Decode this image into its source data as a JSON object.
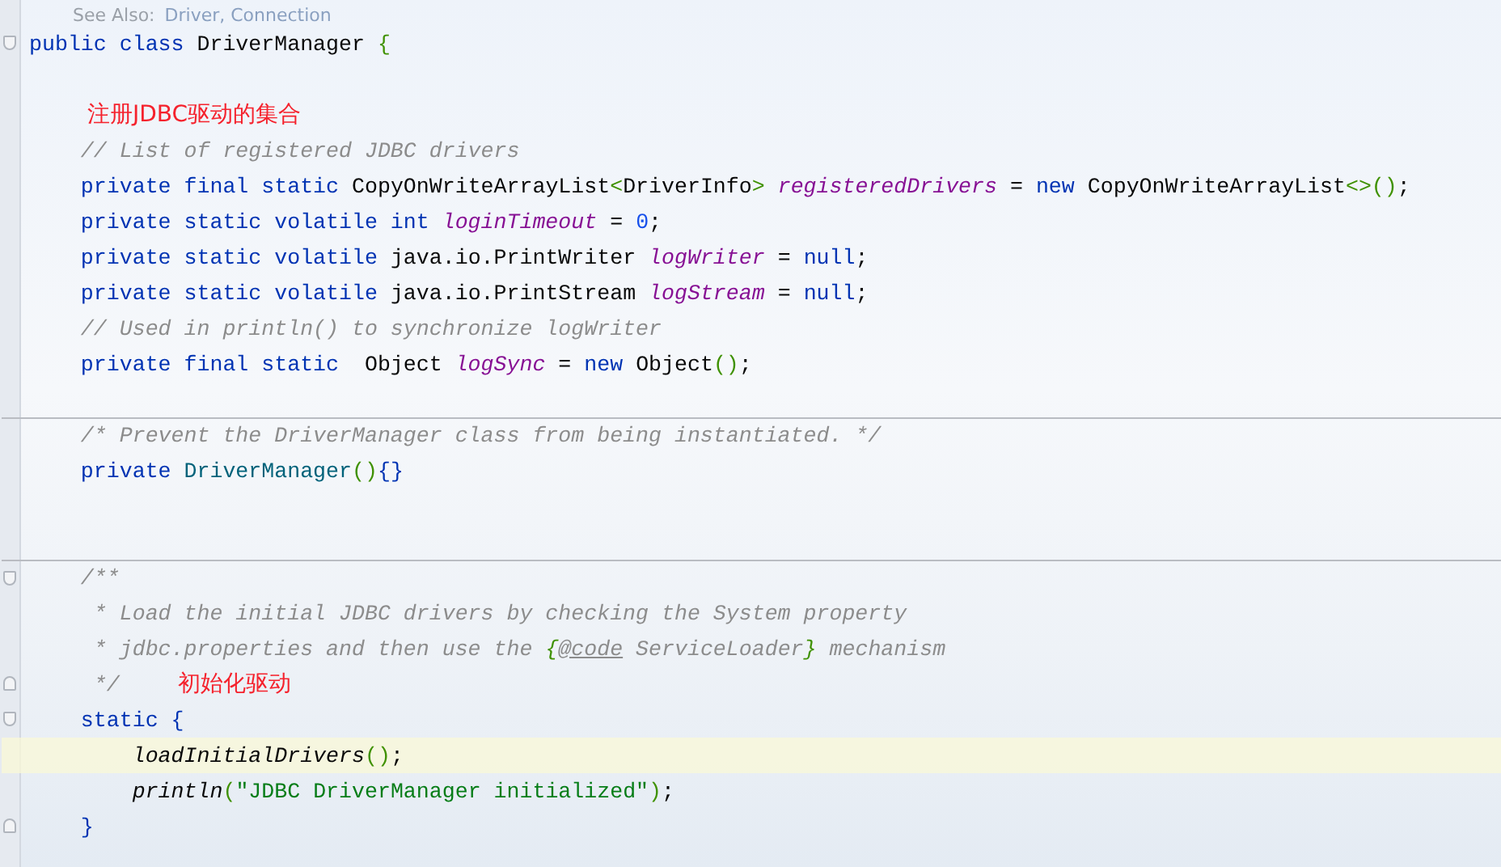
{
  "doc_fragment": {
    "label": "See Also:",
    "links": "Driver, Connection"
  },
  "rows": [
    {
      "fold_start": true,
      "tokens": [
        {
          "kind": "kw",
          "text": "public class "
        },
        {
          "kind": "plain",
          "text": "DriverManager "
        },
        {
          "kind": "brace",
          "text": "{"
        }
      ]
    },
    {
      "tokens": []
    },
    {
      "tokens": [],
      "note": "注册JDBC驱动的集合"
    },
    {
      "tokens": [
        {
          "kind": "comment",
          "text": "    // List of registered JDBC drivers"
        }
      ]
    },
    {
      "tokens": [
        {
          "kind": "kw",
          "text": "    private final static "
        },
        {
          "kind": "plain",
          "text": "CopyOnWriteArrayList"
        },
        {
          "kind": "brace",
          "text": "<"
        },
        {
          "kind": "plain",
          "text": "DriverInfo"
        },
        {
          "kind": "brace",
          "text": ">"
        },
        {
          "kind": "field",
          "text": " registeredDrivers"
        },
        {
          "kind": "plain",
          "text": " = "
        },
        {
          "kind": "kw",
          "text": "new "
        },
        {
          "kind": "plain",
          "text": "CopyOnWriteArrayList"
        },
        {
          "kind": "brace",
          "text": "<>()"
        },
        {
          "kind": "plain",
          "text": ";"
        }
      ]
    },
    {
      "tokens": [
        {
          "kind": "kw",
          "text": "    private static volatile int "
        },
        {
          "kind": "field",
          "text": "loginTimeout"
        },
        {
          "kind": "plain",
          "text": " = "
        },
        {
          "kind": "num",
          "text": "0"
        },
        {
          "kind": "plain",
          "text": ";"
        }
      ]
    },
    {
      "tokens": [
        {
          "kind": "kw",
          "text": "    private static volatile "
        },
        {
          "kind": "plain",
          "text": "java.io.PrintWriter "
        },
        {
          "kind": "field",
          "text": "logWriter"
        },
        {
          "kind": "plain",
          "text": " = "
        },
        {
          "kind": "kw",
          "text": "null"
        },
        {
          "kind": "plain",
          "text": ";"
        }
      ]
    },
    {
      "tokens": [
        {
          "kind": "kw",
          "text": "    private static volatile "
        },
        {
          "kind": "plain",
          "text": "java.io.PrintStream "
        },
        {
          "kind": "field",
          "text": "logStream"
        },
        {
          "kind": "plain",
          "text": " = "
        },
        {
          "kind": "kw",
          "text": "null"
        },
        {
          "kind": "plain",
          "text": ";"
        }
      ]
    },
    {
      "tokens": [
        {
          "kind": "comment",
          "text": "    // Used in println() to synchronize logWriter"
        }
      ]
    },
    {
      "tokens": [
        {
          "kind": "kw",
          "text": "    private final static  "
        },
        {
          "kind": "plain",
          "text": "Object "
        },
        {
          "kind": "field",
          "text": "logSync"
        },
        {
          "kind": "plain",
          "text": " = "
        },
        {
          "kind": "kw",
          "text": "new "
        },
        {
          "kind": "plain",
          "text": "Object"
        },
        {
          "kind": "brace",
          "text": "()"
        },
        {
          "kind": "plain",
          "text": ";"
        }
      ]
    },
    {
      "tokens": []
    },
    {
      "separator": true,
      "tokens": [
        {
          "kind": "comment",
          "text": "    /* Prevent the DriverManager class from being instantiated. */"
        }
      ]
    },
    {
      "tokens": [
        {
          "kind": "kw",
          "text": "    private "
        },
        {
          "kind": "decl",
          "text": "DriverManager"
        },
        {
          "kind": "brace",
          "text": "()"
        },
        {
          "kind": "kw",
          "text": "{}"
        }
      ]
    },
    {
      "tokens": []
    },
    {
      "tokens": []
    },
    {
      "separator": true,
      "fold_start": true,
      "tokens": [
        {
          "kind": "comment",
          "text": "    /**"
        }
      ]
    },
    {
      "tokens": [
        {
          "kind": "comment",
          "text": "     * Load the initial JDBC drivers by checking the System property"
        }
      ]
    },
    {
      "tokens": [
        {
          "kind": "comment",
          "text": "     * jdbc.properties and then use the "
        },
        {
          "kind": "docbrace",
          "text": "{"
        },
        {
          "kind": "doctag",
          "text": "@code"
        },
        {
          "kind": "comment",
          "text": " ServiceLoader"
        },
        {
          "kind": "docbrace",
          "text": "}"
        },
        {
          "kind": "comment",
          "text": " mechanism"
        }
      ]
    },
    {
      "fold_end": true,
      "tokens": [
        {
          "kind": "comment",
          "text": "     */"
        }
      ],
      "note": "初始化驱动"
    },
    {
      "fold_start": true,
      "tokens": [
        {
          "kind": "kw",
          "text": "    static "
        },
        {
          "kind": "kw",
          "text": "{"
        }
      ]
    },
    {
      "current": true,
      "tokens": [
        {
          "kind": "call",
          "text": "        loadInitialDrivers"
        },
        {
          "kind": "brace",
          "text": "()"
        },
        {
          "kind": "plain",
          "text": ";"
        }
      ]
    },
    {
      "tokens": [
        {
          "kind": "call",
          "text": "        println"
        },
        {
          "kind": "brace",
          "text": "("
        },
        {
          "kind": "str",
          "text": "\"JDBC DriverManager initialized\""
        },
        {
          "kind": "brace",
          "text": ")"
        },
        {
          "kind": "plain",
          "text": ";"
        }
      ]
    },
    {
      "fold_end": true,
      "tokens": [
        {
          "kind": "kw",
          "text": "    }"
        }
      ]
    }
  ]
}
